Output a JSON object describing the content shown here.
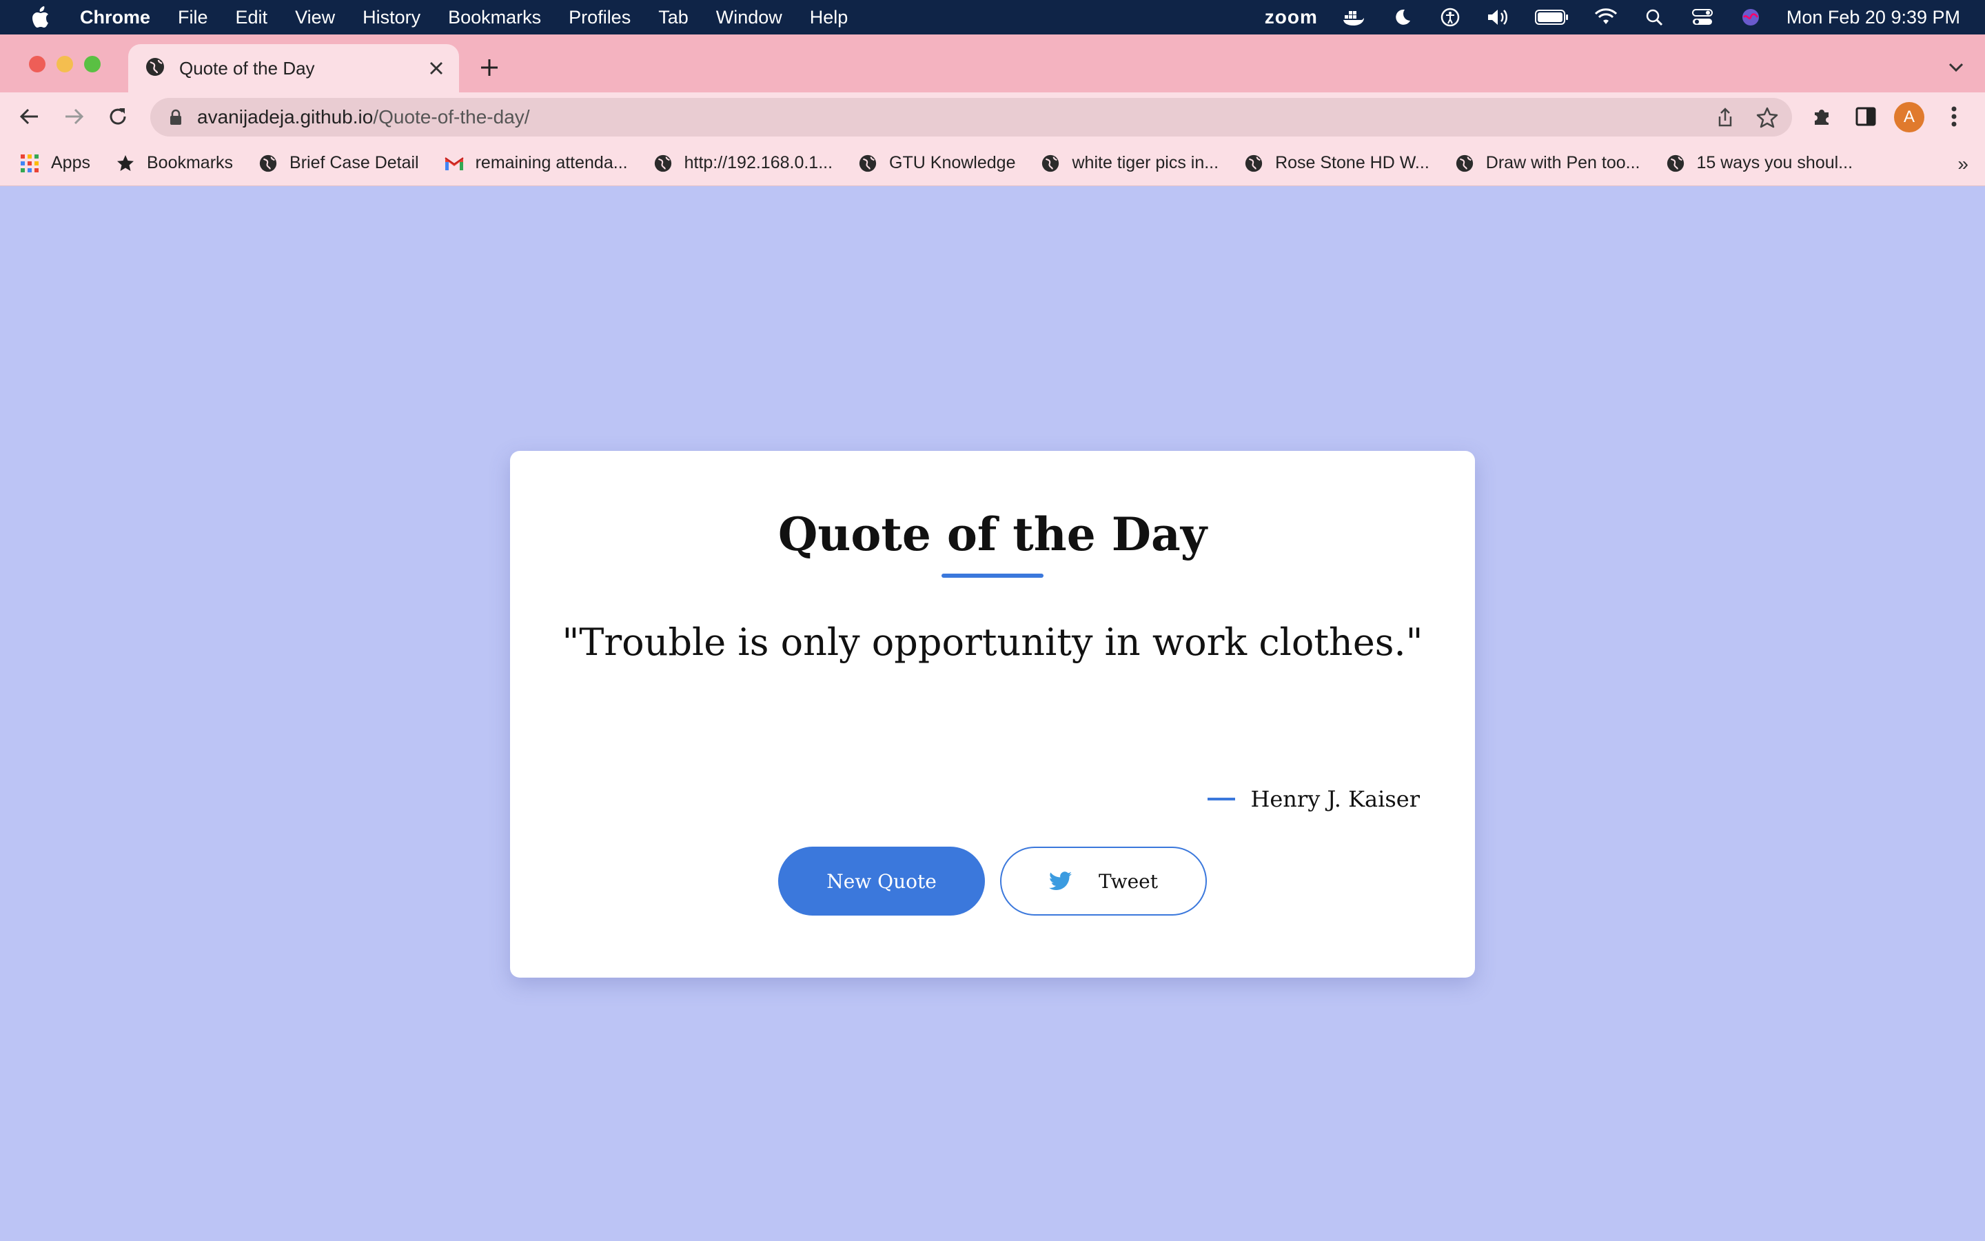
{
  "menubar": {
    "app": "Chrome",
    "items": [
      "File",
      "Edit",
      "View",
      "History",
      "Bookmarks",
      "Profiles",
      "Tab",
      "Window",
      "Help"
    ],
    "zoom_label": "zoom",
    "datetime": "Mon Feb 20  9:39 PM"
  },
  "browser": {
    "tab_title": "Quote of the Day",
    "url_host": "avanijadeja.github.io",
    "url_path": "/Quote-of-the-day/",
    "profile_initial": "A"
  },
  "bookmarks": [
    {
      "label": "Apps",
      "icon": "apps-grid-icon"
    },
    {
      "label": "Bookmarks",
      "icon": "star-icon"
    },
    {
      "label": "Brief Case Detail",
      "icon": "globe-icon"
    },
    {
      "label": "remaining attenda...",
      "icon": "gmail-icon"
    },
    {
      "label": "http://192.168.0.1...",
      "icon": "globe-icon"
    },
    {
      "label": "GTU Knowledge",
      "icon": "globe-icon"
    },
    {
      "label": "white tiger pics in...",
      "icon": "globe-icon"
    },
    {
      "label": "Rose Stone HD W...",
      "icon": "globe-icon"
    },
    {
      "label": "Draw with Pen too...",
      "icon": "globe-icon"
    },
    {
      "label": "15 ways you shoul...",
      "icon": "globe-icon"
    }
  ],
  "bookmarks_more": "»",
  "page": {
    "title": "Quote of the Day",
    "quote": "\"Trouble is only opportunity in work clothes.\"",
    "author": "Henry J. Kaiser",
    "new_quote_label": "New Quote",
    "tweet_label": "Tweet"
  },
  "colors": {
    "page_background": "#bcc4f5",
    "accent": "#3b78dc",
    "tab_strip": "#f4b3c0"
  }
}
